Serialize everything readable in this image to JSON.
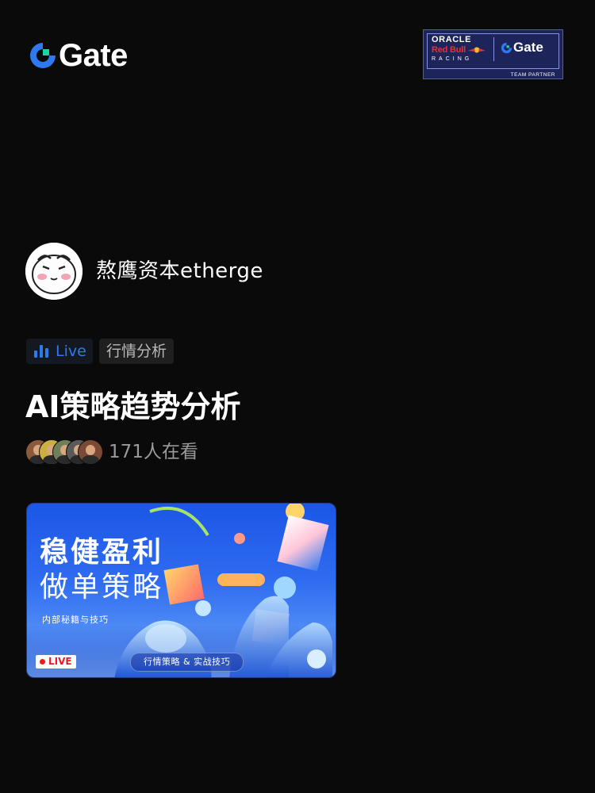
{
  "brand": {
    "logo_text": "Gate",
    "accent_color": "#2e79f0"
  },
  "partner_badge": {
    "oracle": "ORACLE",
    "red_bull": "Red Bull",
    "racing": "RACING",
    "gate": "Gate",
    "team_partner": "TEAM PARTNER"
  },
  "host": {
    "name": "熬鹰资本etherge"
  },
  "tags": {
    "live_label": "Live",
    "category": "行情分析"
  },
  "stream": {
    "title": "AI策略趋势分析",
    "viewer_count": "171人在看"
  },
  "thumbnail": {
    "headline_line1": "稳健盈利",
    "headline_line2": "做单策略",
    "subtitle": "内部秘籍与技巧",
    "live_badge": "LIVE",
    "pill_text": "行情策略 & 实战技巧",
    "live_color": "#e51c23"
  }
}
